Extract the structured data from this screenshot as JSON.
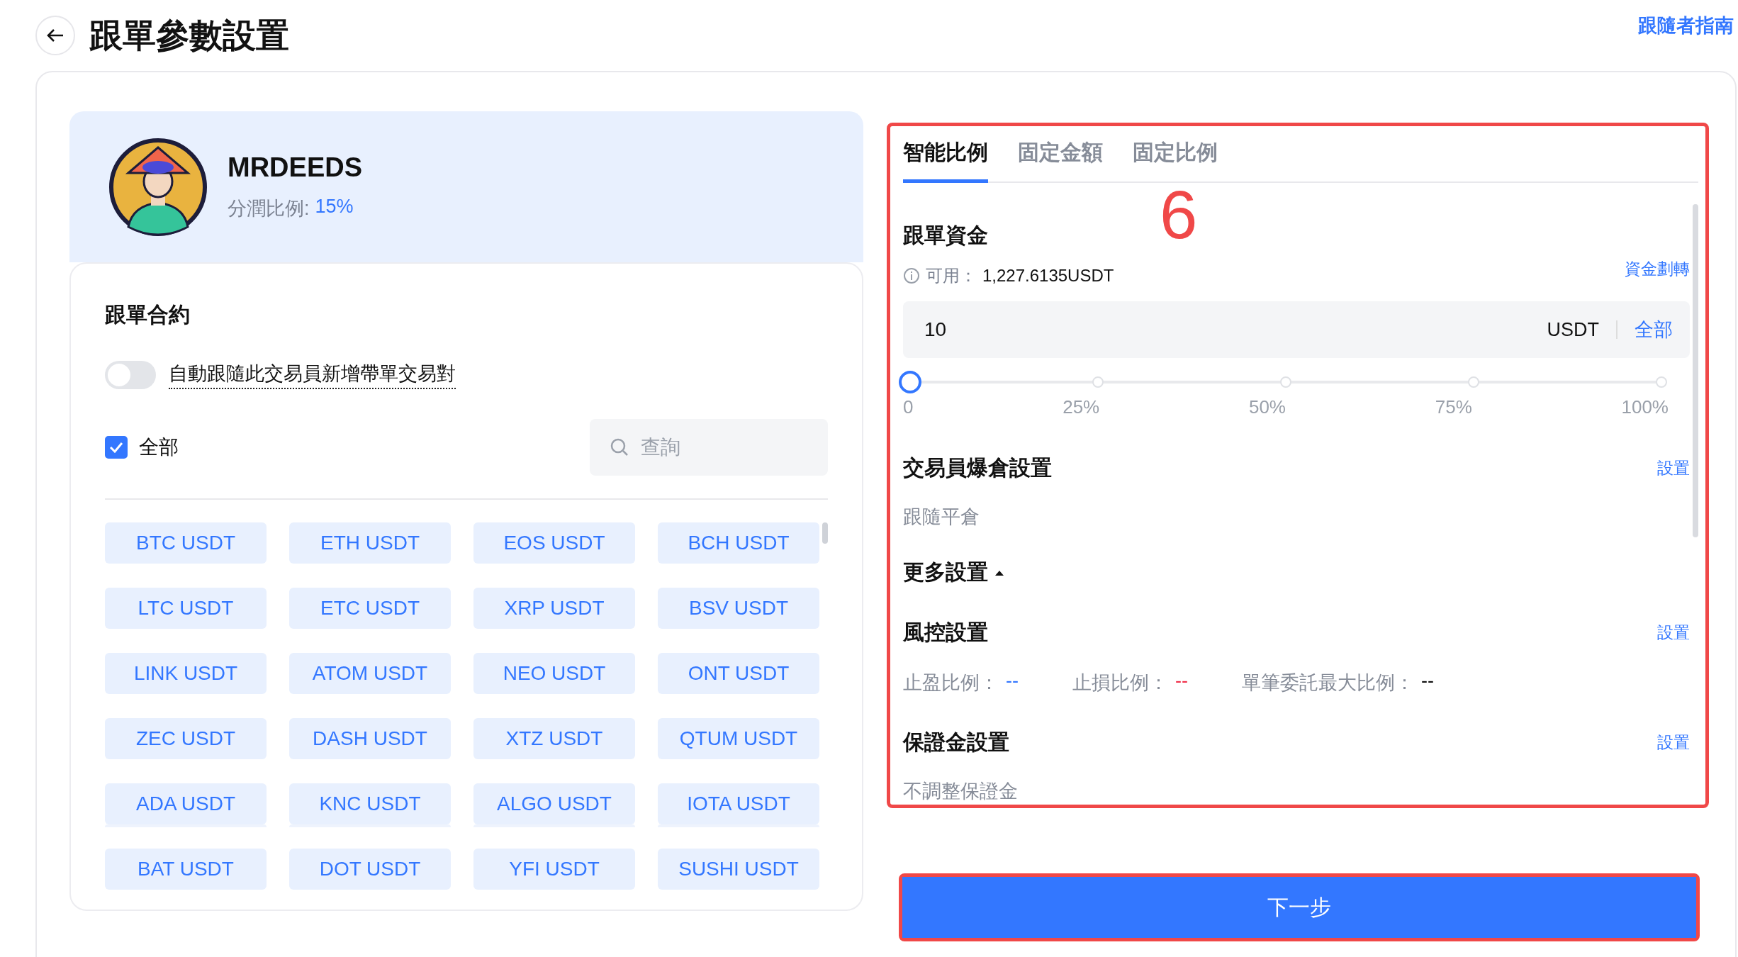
{
  "header": {
    "title": "跟單參數設置",
    "guide_link": "跟隨者指南"
  },
  "trader": {
    "name": "MRDEEDS",
    "share_label": "分潤比例:",
    "share_value": "15%"
  },
  "contracts": {
    "title": "跟單合約",
    "auto_follow": {
      "label": "自動跟隨此交易員新增帶單交易對",
      "on": false
    },
    "select_all": {
      "label": "全部",
      "checked": true
    },
    "search": {
      "placeholder": "查詢"
    },
    "pairs": [
      "BTC USDT",
      "ETH USDT",
      "EOS USDT",
      "BCH USDT",
      "LTC USDT",
      "ETC USDT",
      "XRP USDT",
      "BSV USDT",
      "LINK USDT",
      "ATOM USDT",
      "NEO USDT",
      "ONT USDT",
      "ZEC USDT",
      "DASH USDT",
      "XTZ USDT",
      "QTUM USDT",
      "ADA USDT",
      "KNC USDT",
      "ALGO USDT",
      "IOTA USDT",
      "BAT USDT",
      "DOT USDT",
      "YFI USDT",
      "SUSHI USDT"
    ]
  },
  "settings": {
    "tabs": [
      {
        "label": "智能比例",
        "selected": true
      },
      {
        "label": "固定金額",
        "selected": false
      },
      {
        "label": "固定比例",
        "selected": false
      }
    ],
    "funds": {
      "title": "跟單資金",
      "available_label": "可用：",
      "available_value": "1,227.6135USDT",
      "transfer_link": "資金劃轉",
      "amount": {
        "value": "10",
        "unit": "USDT",
        "all_button": "全部"
      },
      "slider": {
        "level": 0,
        "marks": [
          "0",
          "25%",
          "50%",
          "75%",
          "100%"
        ]
      }
    },
    "liquidation": {
      "title": "交易員爆倉設置",
      "action": "設置",
      "value": "跟隨平倉"
    },
    "more": {
      "label": "更多設置",
      "expanded": true
    },
    "risk": {
      "title": "風控設置",
      "action": "設置",
      "items": [
        {
          "label": "止盈比例：",
          "value": "--",
          "color": "#3377ff"
        },
        {
          "label": "止損比例：",
          "value": "--",
          "color": "#f0304a"
        },
        {
          "label": "單筆委託最大比例：",
          "value": "--",
          "color": "#111111"
        }
      ]
    },
    "margin": {
      "title": "保證金設置",
      "action": "設置",
      "value": "不調整保證金"
    }
  },
  "next_button": "下一步",
  "annotation": {
    "label": "6"
  }
}
